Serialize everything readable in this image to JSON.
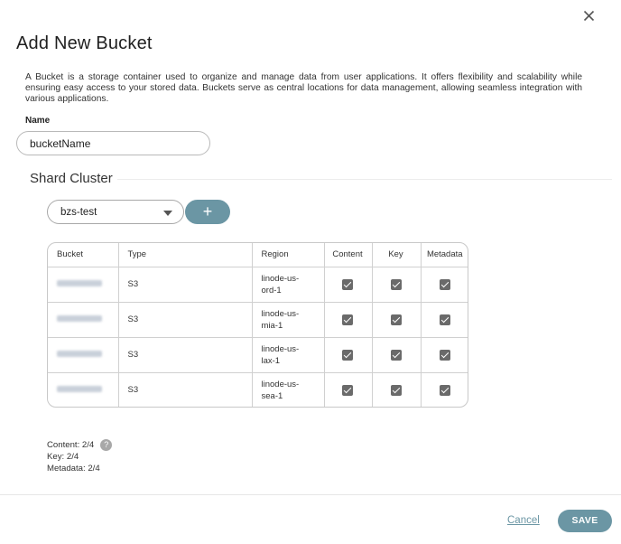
{
  "dialog": {
    "title": "Add New Bucket",
    "description": "A Bucket is a storage container used to organize and manage data from user applications. It offers flexibility and scalability while ensuring easy access to your stored data. Buckets serve as central locations for data management, allowing seamless integration with various applications.",
    "close_icon": "close-icon"
  },
  "name_field": {
    "label": "Name",
    "value": "bucketName"
  },
  "shard_cluster": {
    "title": "Shard Cluster",
    "selected": "bzs-test",
    "add_label": "+"
  },
  "table": {
    "headers": [
      "Bucket",
      "Type",
      "Region",
      "Content",
      "Key",
      "Metadata"
    ],
    "rows": [
      {
        "type": "S3",
        "region": "linode-us-ord-1",
        "content": true,
        "key": true,
        "metadata": true
      },
      {
        "type": "S3",
        "region": "linode-us-mia-1",
        "content": true,
        "key": true,
        "metadata": true
      },
      {
        "type": "S3",
        "region": "linode-us-lax-1",
        "content": true,
        "key": true,
        "metadata": true
      },
      {
        "type": "S3",
        "region": "linode-us-sea-1",
        "content": true,
        "key": true,
        "metadata": true
      }
    ]
  },
  "summary": {
    "content": "Content: 2/4",
    "key": "Key: 2/4",
    "metadata": "Metadata: 2/4",
    "help_glyph": "?"
  },
  "footer": {
    "cancel_label": "Cancel",
    "save_label": "SAVE"
  },
  "colors": {
    "accent": "#6b96a4",
    "checkbox": "#6a6a6a"
  }
}
